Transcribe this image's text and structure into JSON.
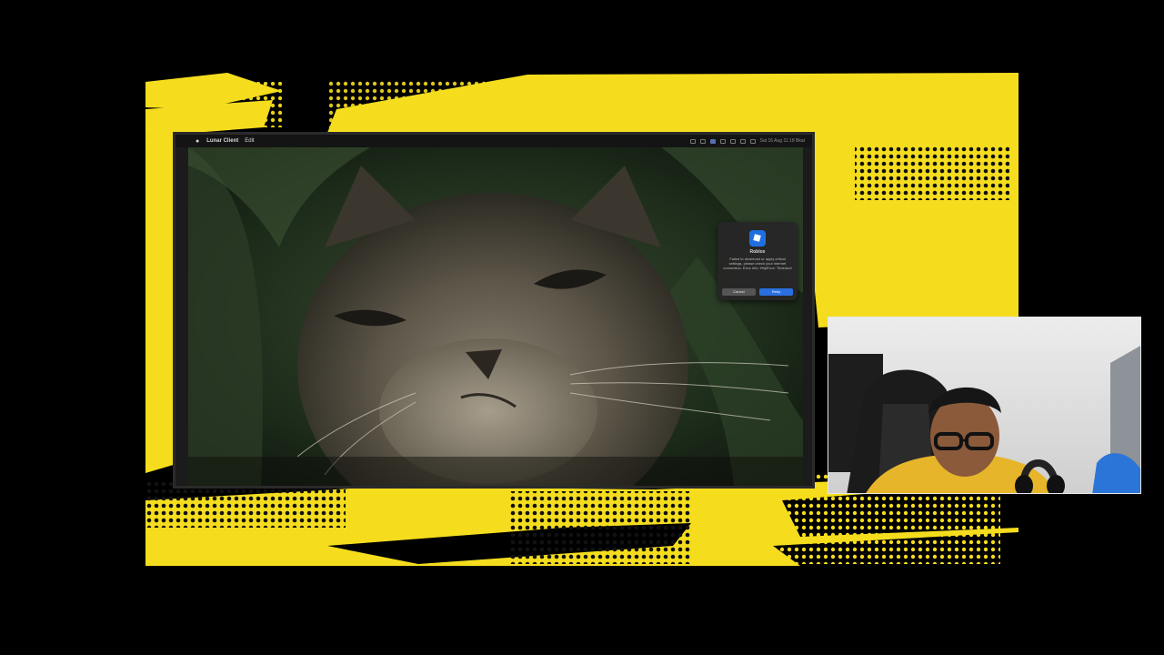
{
  "menubar": {
    "apple_icon": "apple-icon",
    "app_name": "Lunar Client",
    "menu_edit": "Edit",
    "clock": "Sat 16 Aug 11:18 Bkat"
  },
  "notification": {
    "app_icon": "roblox-icon",
    "title": "Roblox",
    "message": "Failed to download or apply critical settings, please check your internet connection. Error info: HttpError: Timedout",
    "cancel_label": "Cancel",
    "retry_label": "Retry"
  },
  "colors": {
    "accent_yellow": "#f5dd1e",
    "retry_blue": "#2a6fe0",
    "background": "#000000"
  }
}
